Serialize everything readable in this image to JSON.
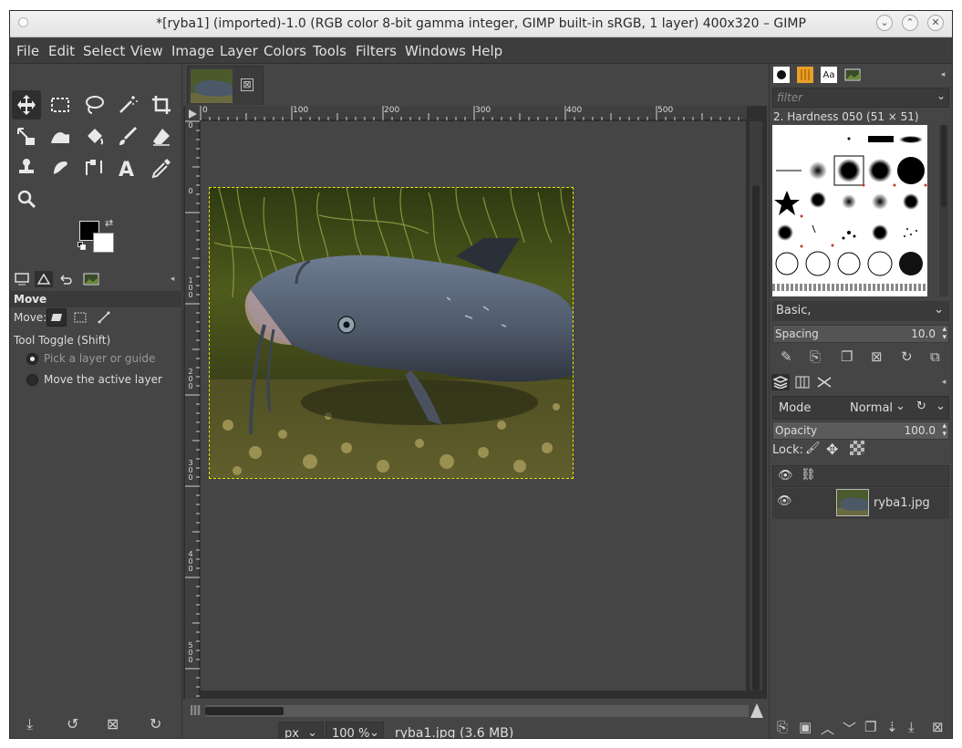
{
  "window": {
    "title": "*[ryba1] (imported)-1.0 (RGB color 8-bit gamma integer, GIMP built-in sRGB, 1 layer) 400x320 – GIMP"
  },
  "menu": [
    "File",
    "Edit",
    "Select",
    "View",
    "Image",
    "Layer",
    "Colors",
    "Tools",
    "Filters",
    "Windows",
    "Help"
  ],
  "toolbox": {
    "tools": [
      "move-tool",
      "rect-select-tool",
      "free-select-tool",
      "fuzzy-select-tool",
      "crop-tool",
      "unified-transform-tool",
      "warp-tool",
      "bucket-fill-tool",
      "paintbrush-tool",
      "eraser-tool",
      "clone-tool",
      "smudge-tool",
      "paths-tool",
      "text-tool",
      "color-picker-tool",
      "zoom-tool"
    ],
    "active_tool": "move-tool",
    "fg_color": "#000000",
    "bg_color": "#ffffff"
  },
  "tool_options": {
    "header": "Move",
    "move_label": "Move:",
    "toggle_label": "Tool Toggle  (Shift)",
    "option_pick": "Pick a layer or guide",
    "option_move_active": "Move the active layer",
    "selected_option": "pick"
  },
  "image": {
    "tab_close": "⊠",
    "ruler_h": [
      "0",
      "100",
      "200",
      "300",
      "400",
      "500"
    ],
    "ruler_v": [
      [
        "0"
      ],
      [
        "0"
      ],
      [
        "1",
        "0",
        "0"
      ],
      [
        "2",
        "0",
        "0"
      ],
      [
        "3",
        "0",
        "0"
      ],
      [
        "4",
        "0",
        "0"
      ],
      [
        "5",
        "0",
        "0"
      ]
    ],
    "unit": "px",
    "zoom": "100 %",
    "status": "ryba1.jpg (3.6 MB)"
  },
  "brushes": {
    "filter_placeholder": "filter",
    "selected_brush": "2. Hardness 050 (51 × 51)",
    "preset": "Basic,",
    "spacing_label": "Spacing",
    "spacing_value": "10.0"
  },
  "layers": {
    "mode_label": "Mode",
    "mode_value": "Normal",
    "opacity_label": "Opacity",
    "opacity_value": "100.0",
    "lock_label": "Lock:",
    "items": [
      {
        "name": "ryba1.jpg",
        "visible": true
      }
    ]
  }
}
